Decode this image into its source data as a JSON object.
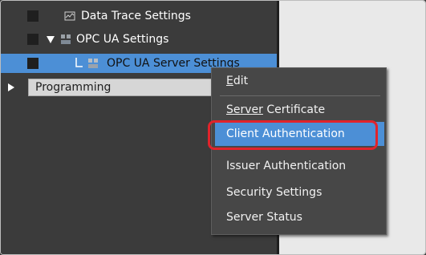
{
  "tree": {
    "items": [
      {
        "label": "Data Trace Settings",
        "icon": "trace-settings-icon"
      },
      {
        "label": "OPC UA Settings",
        "icon": "opcua-icon"
      },
      {
        "label": "OPC UA Server Settings",
        "icon": "opcua-server-icon"
      }
    ],
    "programming_label": "Programming"
  },
  "context_menu": {
    "items": [
      {
        "label_underlined": "E",
        "label_rest": "dit"
      },
      {
        "label_underlined": "Server",
        "label_rest": " Certificate"
      },
      {
        "label": "Client Authentication"
      },
      {
        "label": "Issuer Authentication"
      },
      {
        "label": "Security Settings"
      },
      {
        "label": "Server Status"
      }
    ]
  },
  "colors": {
    "selection": "#4c8fd6",
    "callout": "#e1232b",
    "pane_bg": "#3b3b3b",
    "menu_bg": "#474747"
  }
}
